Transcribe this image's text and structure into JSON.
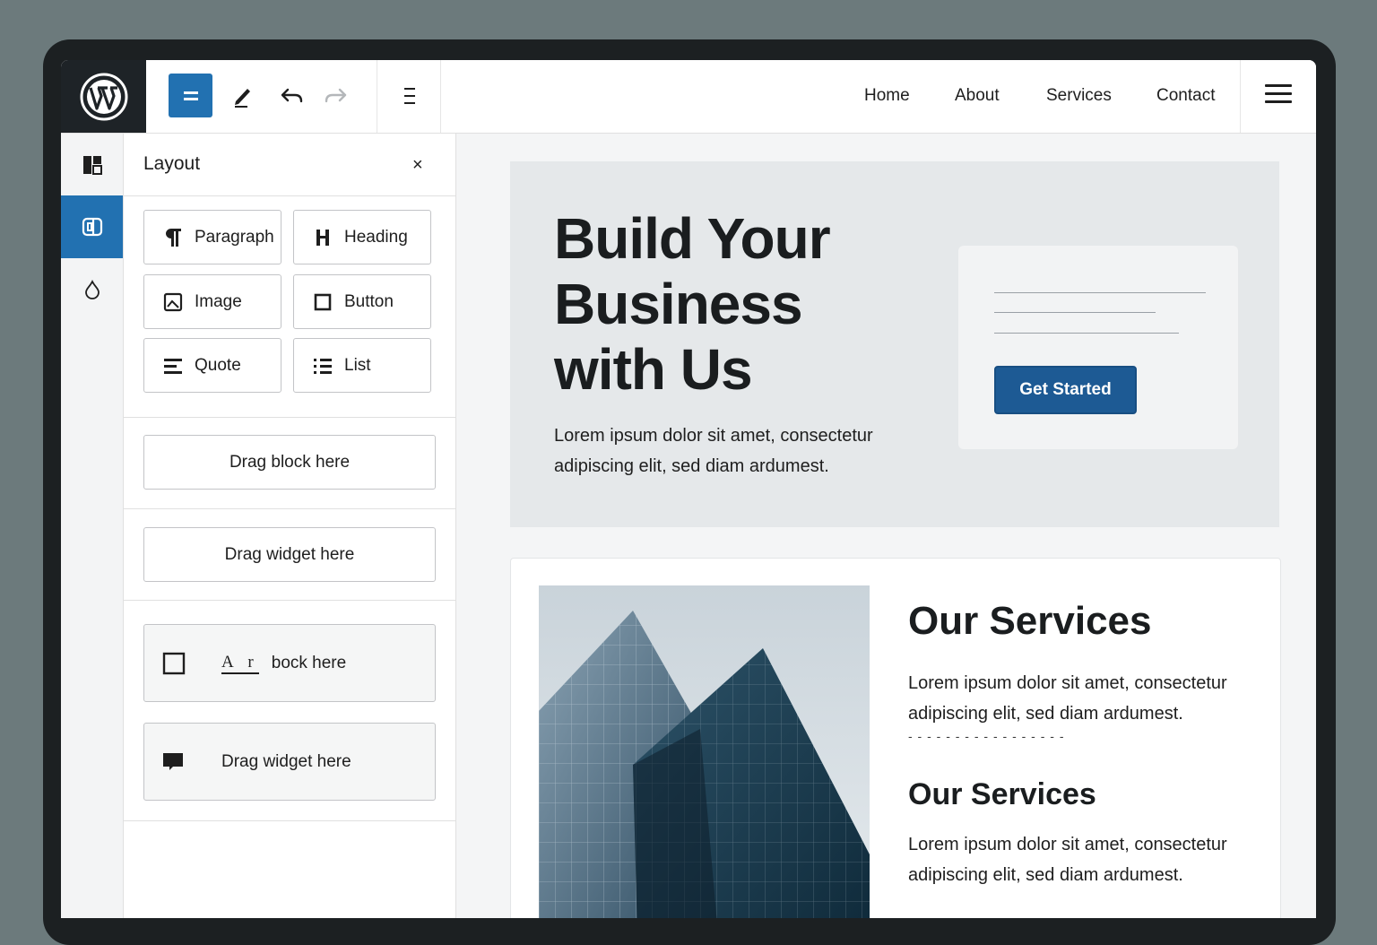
{
  "toolbar": {
    "logo": "wordpress-logo",
    "tools": [
      "block-inserter-icon",
      "edit-pencil-icon",
      "undo-icon",
      "redo-icon",
      "list-view-icon"
    ]
  },
  "nav": {
    "items": [
      "Home",
      "About",
      "Services",
      "Contact"
    ]
  },
  "rail": {
    "items": [
      "layout-icon",
      "blocks-icon",
      "styles-drop-icon"
    ],
    "active_index": 1
  },
  "panel": {
    "title": "Layout",
    "close": "×",
    "blocks": [
      {
        "label": "Paragraph",
        "icon": "paragraph-icon"
      },
      {
        "label": "Heading",
        "icon": "heading-icon"
      },
      {
        "label": "Image",
        "icon": "image-icon"
      },
      {
        "label": "Button",
        "icon": "button-icon"
      },
      {
        "label": "Quote",
        "icon": "quote-icon"
      },
      {
        "label": "List",
        "icon": "list-icon"
      }
    ],
    "drop_block": "Drag block here",
    "drop_widget": "Drag widget here",
    "drop_mixed_glyph": "A r",
    "drop_mixed_text": "bock here",
    "drop_widget_2": "Drag widget here"
  },
  "hero": {
    "title": "Build Your Business with Us",
    "text": "Lorem ipsum dolor sit amet, consectetur adipiscing elit, sed diam ardumest.",
    "cta": "Get Started"
  },
  "services": {
    "heading_1": "Our Services",
    "text_1": "Lorem ipsum dolor sit amet, consectetur adipiscing elit, sed diam ardumest.",
    "divider": "- - - - - - - - - - - - - - - - -",
    "heading_2": "Our Services",
    "text_2": "Lorem ipsum dolor sit amet, consectetur adipiscing elit, sed diam ardumest."
  },
  "colors": {
    "accent": "#2271b1",
    "cta": "#1d5a94",
    "frame": "#1c2022"
  }
}
